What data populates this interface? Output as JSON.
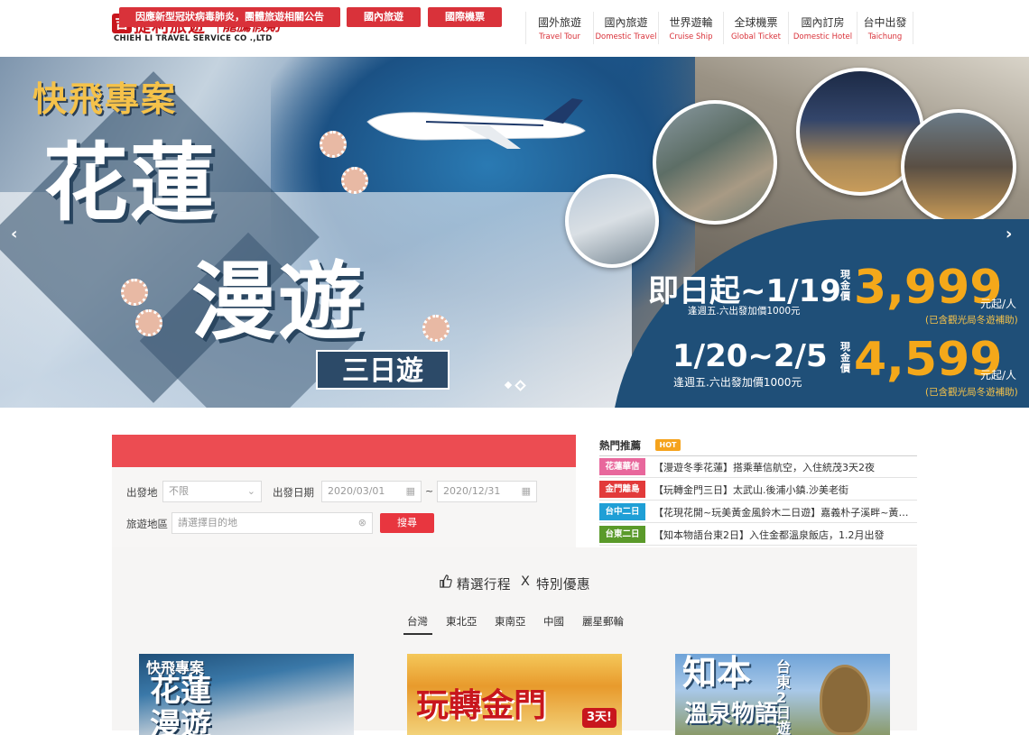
{
  "header": {
    "logo": {
      "mark": "吉",
      "name": "捷利旅遊",
      "script": "龍騰假期",
      "english": "CHIEH LI TRAVEL SERVICE CO .,LTD"
    },
    "nav": [
      {
        "zh": "國外旅遊",
        "en": "Travel Tour"
      },
      {
        "zh": "國內旅遊",
        "en": "Domestic Travel"
      },
      {
        "zh": "世界遊輪",
        "en": "Cruise Ship"
      },
      {
        "zh": "全球機票",
        "en": "Global Ticket"
      },
      {
        "zh": "國內訂房",
        "en": "Domestic Hotel"
      },
      {
        "zh": "台中出發",
        "en": "Taichung"
      }
    ]
  },
  "banner": {
    "kicker": "快飛專案",
    "title_line1": "花蓮",
    "title_line2": "漫遊",
    "tag": "三日遊",
    "offers": [
      {
        "dates": "即日起~1/19",
        "note": "逢週五.六出發加價1000元",
        "cash_label": "現金價",
        "price": "3,999",
        "unit": "元起/人",
        "sub": "(已含觀光局冬遊補助)"
      },
      {
        "dates": "1/20~2/5",
        "note": "逢週五.六出發加價1000元",
        "cash_label": "現金價",
        "price": "4,599",
        "unit": "元起/人",
        "sub": "(已含觀光局冬遊補助)"
      }
    ],
    "prev_arrow": "‹",
    "next_arrow": "›",
    "slide_count": 2,
    "active_slide": 2
  },
  "search": {
    "tabs": [
      "因應新型冠狀病毒肺炎，團體旅遊相關公告",
      "國內旅遊",
      "國際機票"
    ],
    "origin_label": "出發地",
    "origin_value": "不限",
    "date_label": "出發日期",
    "date_from": "2020/03/01",
    "date_to": "2020/12/31",
    "date_separator": "~",
    "region_label": "旅遊地區",
    "region_placeholder": "請選擇目的地",
    "submit": "搜尋"
  },
  "hot": {
    "title": "熱門推薦",
    "badge": "HOT",
    "items": [
      {
        "tag": "花蓮華信",
        "tag_color": "#e8679c",
        "text": "【漫遊冬季花蓮】搭乘華信航空，入住統茂3天2夜"
      },
      {
        "tag": "金門離島",
        "tag_color": "#e23a3a",
        "text": "【玩轉金門三日】太武山.後浦小鎮.沙美老街"
      },
      {
        "tag": "台中二日",
        "tag_color": "#1f9fd6",
        "text": "【花現花開~玩美黃金風鈴木二日遊】嘉義朴子溪畔~黃花風鈴木"
      },
      {
        "tag": "台東二日",
        "tag_color": "#5a9a2a",
        "text": "【知本物語台東2日】入住金都溫泉飯店，1.2月出發"
      }
    ]
  },
  "featured": {
    "title_left": "精選行程",
    "title_x": "X",
    "title_right": "特別優惠",
    "tabs": [
      "台灣",
      "東北亞",
      "東南亞",
      "中國",
      "麗星郵輪"
    ],
    "active_tab": "台灣",
    "cards": [
      {
        "kicker": "快飛專案",
        "title": "花蓮\n漫遊"
      },
      {
        "title": "玩轉金門",
        "badge": "3天!"
      },
      {
        "title": "知本",
        "subtitle": "溫泉物語",
        "vertical": "台東2日遊"
      }
    ]
  },
  "colors": {
    "brand_red": "#c8161d",
    "search_bar": "#ec4c52",
    "price_orange": "#f4a81a",
    "banner_blue": "#1f4f78"
  }
}
